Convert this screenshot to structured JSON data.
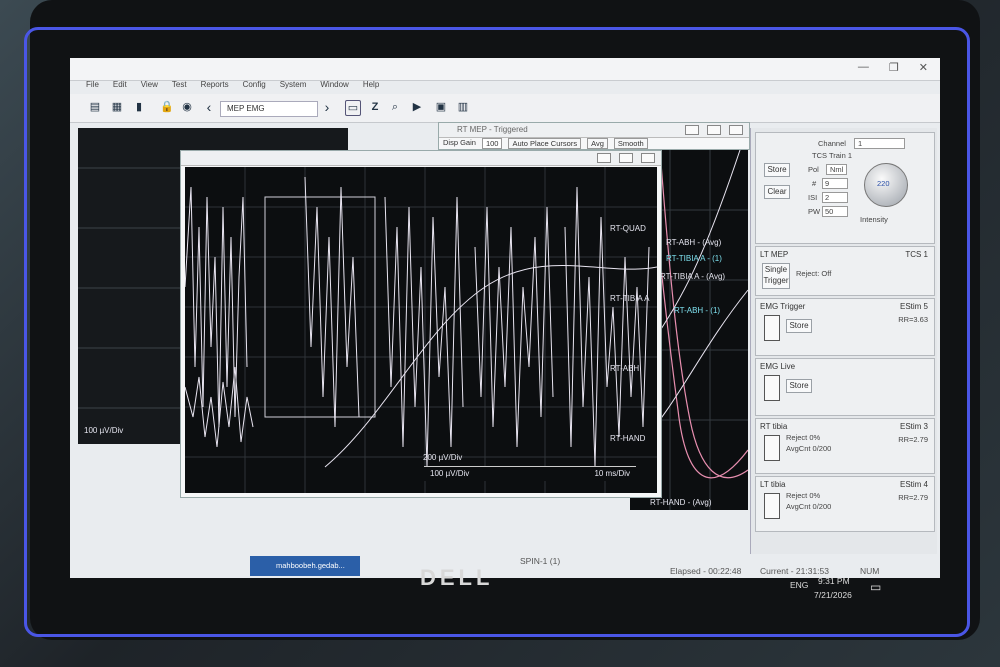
{
  "app": {
    "menu": [
      "File",
      "Edit",
      "View",
      "Test",
      "Reports",
      "Config",
      "System",
      "Window",
      "Help"
    ],
    "program_select": "MEP EMG",
    "window_buttons": [
      "—",
      "❐",
      "✕"
    ]
  },
  "windows": {
    "mep_title": "RT MEP - Triggered",
    "disp_gain_label": "Disp Gain",
    "disp_gain_value": "100",
    "auto_place_label": "Auto Place Cursors",
    "avg_label": "Avg",
    "smooth_label": "Smooth",
    "left_scale": "100 µV/Div",
    "mid_scale": "200 µV/Div",
    "bottom_scale": "100 µV/Div",
    "time_scale": "10 ms/Div"
  },
  "traces": {
    "rt_quad": "RT-QUAD",
    "rt_tibia_a_mid": "RT-TIBIA A",
    "rt_abh_mid": "RT-ABH",
    "rt_hand_mid": "RT-HAND",
    "rt_abh_avg": "RT-ABH - (Avg)",
    "rt_tibia_1": "RT-TIBIA A - (1)",
    "rt_tibia_avg": "RT-TIBIA A - (Avg)",
    "rt_abh_1": "RT-ABH - (1)",
    "rt_hand_avg": "RT-HAND - (Avg)"
  },
  "side": {
    "channel_label": "Channel",
    "channel_value": "1",
    "tcs_train": "TCS Train 1",
    "store": "Store",
    "clear": "Clear",
    "pol_label": "Pol",
    "pol_value": "Nml",
    "num_label": "#",
    "num_value": "9",
    "isi_label": "ISI",
    "isi_value": "2",
    "pw_label": "PW",
    "pw_value": "50",
    "knob_value": "220",
    "intensity": "Intensity",
    "lt_mep": "LT MEP",
    "tcs_1": "TCS 1",
    "single_trigger": "Single Trigger",
    "reject_off": "Reject: Off",
    "emg_trigger": "EMG Trigger",
    "estim_5": "EStim 5",
    "rr_363": "RR=3.63",
    "emg_live": "EMG Live",
    "rt_tibia": "RT tibia",
    "estim_3": "EStim 3",
    "rr_279a": "RR=2.79",
    "reject_0": "Reject 0%",
    "avgcnt": "AvgCnt 0/200",
    "lt_tibia": "LT tibia",
    "estim_4": "EStim 4",
    "rr_279b": "RR=2.79"
  },
  "status": {
    "spin": "SPIN-1 (1)",
    "elapsed": "Elapsed - 00:22:48",
    "current": "Current - 21:31:53",
    "num": "NUM",
    "taskbar_app": "mahboobeh.gedab..."
  },
  "tray": {
    "lang": "ENG",
    "time": "9:31 PM",
    "date": "7/21/2026"
  },
  "brand": "DELL",
  "colors": {
    "frame": "#4a56e6",
    "trace": "#e8e4f0",
    "trace_pink": "#e88fb0",
    "plot_bg": "#0c0e10"
  }
}
